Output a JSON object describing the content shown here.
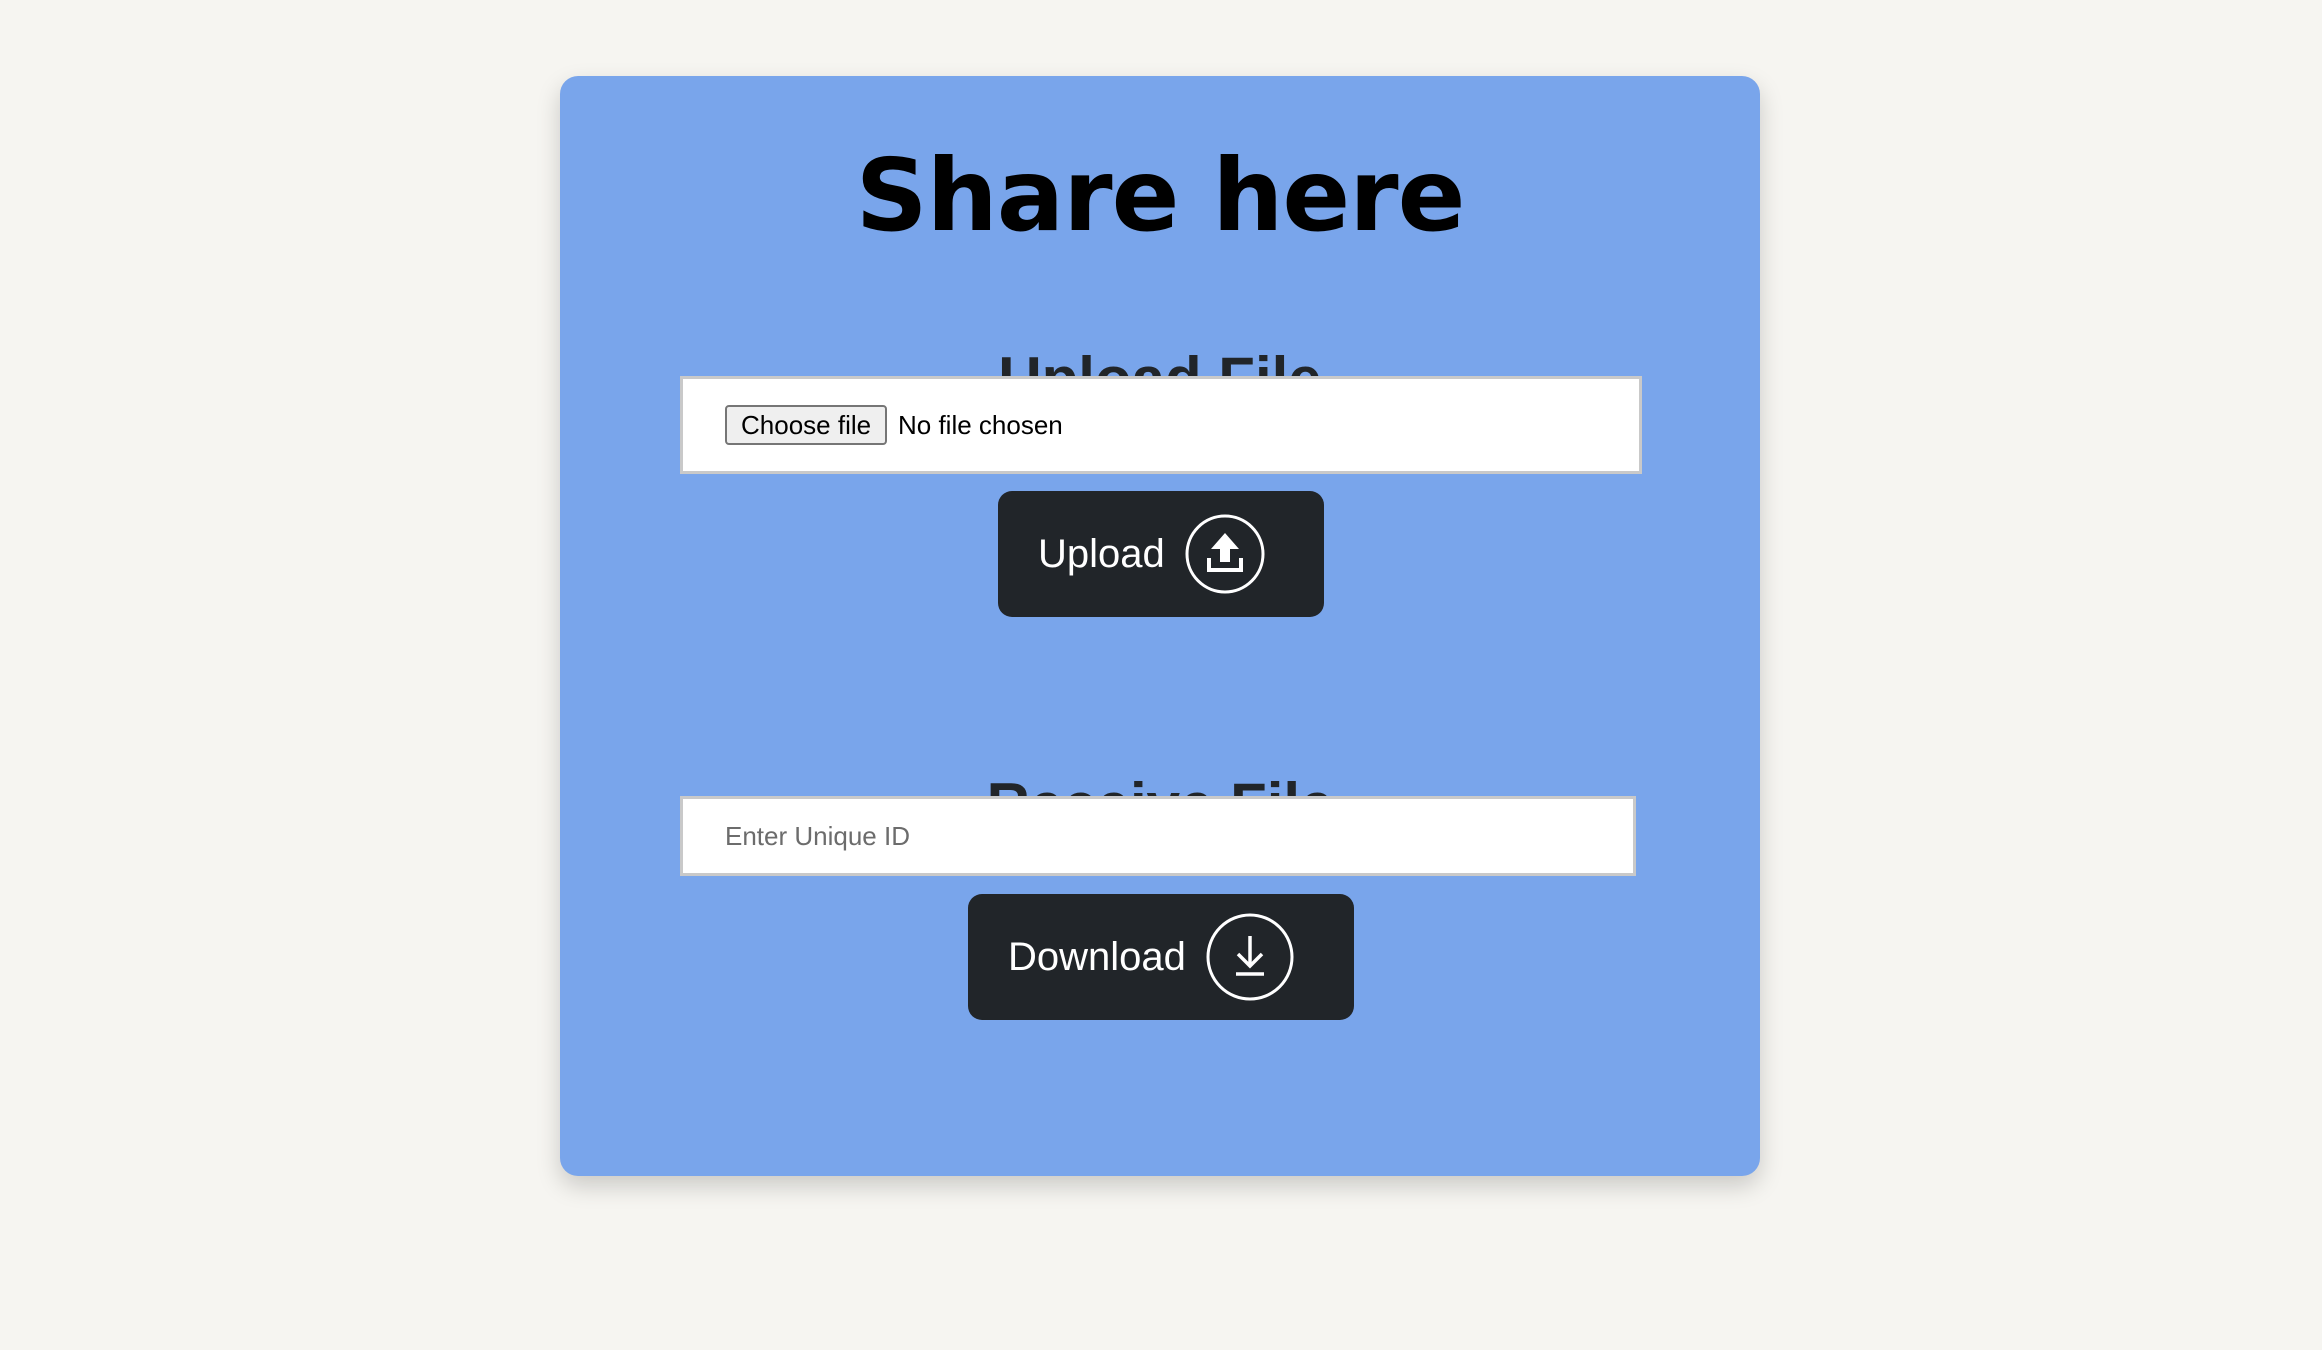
{
  "app": {
    "title": "Share here"
  },
  "upload": {
    "heading": "Upload File",
    "choose_label": "Choose file",
    "file_status": "No file chosen",
    "button_label": "Upload",
    "button_icon": "upload-icon"
  },
  "receive": {
    "heading": "Receive File",
    "id_placeholder": "Enter Unique ID",
    "id_value": "",
    "button_label": "Download",
    "button_icon": "download-icon"
  },
  "colors": {
    "page_background": "#f6f5f1",
    "card_background": "#79a5eb",
    "button_background": "#212529",
    "heading_text": "#212529"
  }
}
